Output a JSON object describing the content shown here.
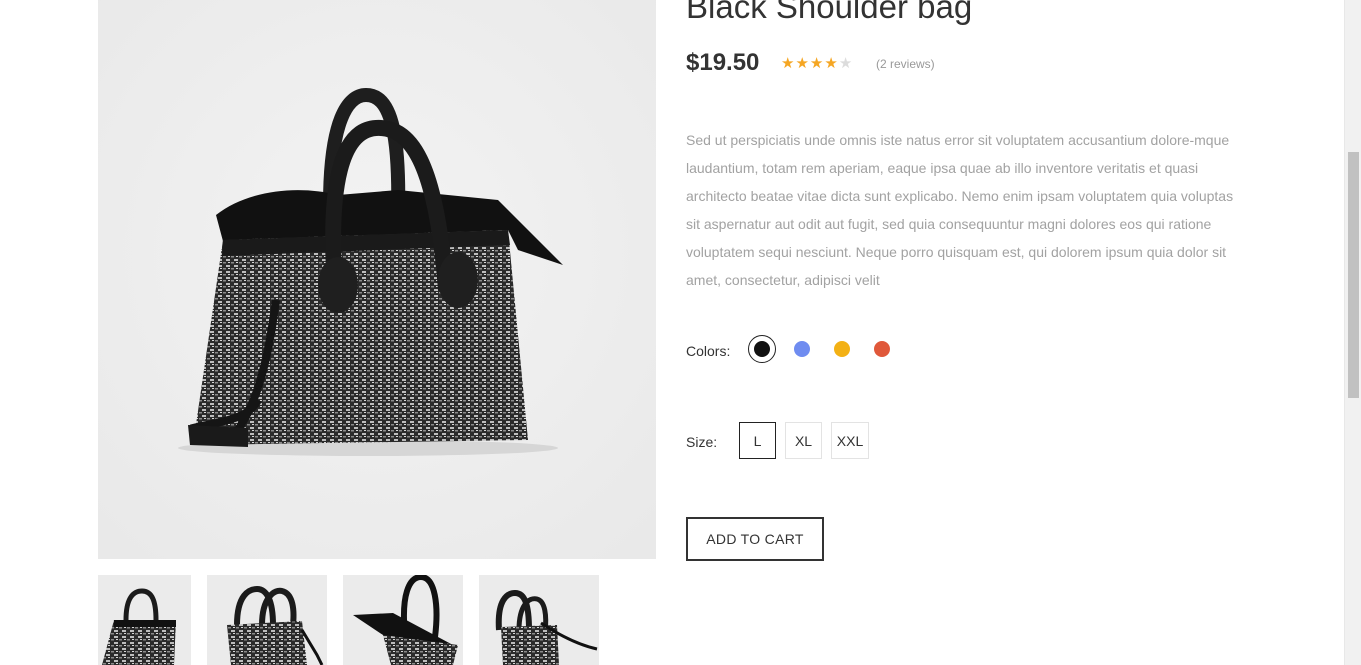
{
  "product": {
    "title": "Black Shoulder bag",
    "price": "$19.50",
    "rating": 4,
    "rating_max": 5,
    "reviews_text": "(2 reviews)",
    "description": "Sed ut perspiciatis unde omnis iste natus error sit voluptatem accusantium dolore-mque laudantium, totam rem aperiam, eaque ipsa quae ab illo inventore veritatis et quasi architecto beatae vitae dicta sunt explicabo. Nemo enim ipsam voluptatem quia voluptas sit aspernatur aut odit aut fugit, sed quia consequuntur magni dolores eos qui ratione voluptatem sequi nesciunt. Neque porro quisquam est, qui dolorem ipsum quia dolor sit amet, consectetur, adipisci velit"
  },
  "options": {
    "colors_label": "Colors:",
    "colors": [
      {
        "name": "black",
        "hex": "#111111",
        "selected": true
      },
      {
        "name": "blue",
        "hex": "#6f8cf0",
        "selected": false
      },
      {
        "name": "yellow",
        "hex": "#f3b115",
        "selected": false
      },
      {
        "name": "red",
        "hex": "#e0583a",
        "selected": false
      }
    ],
    "size_label": "Size:",
    "sizes": [
      {
        "label": "L",
        "selected": true
      },
      {
        "label": "XL",
        "selected": false
      },
      {
        "label": "XXL",
        "selected": false
      }
    ]
  },
  "actions": {
    "add_to_cart_label": "ADD TO CART"
  },
  "gallery": {
    "main_image": "black-woven-shoulder-bag-front",
    "thumbnails": [
      "bag-front",
      "bag-side",
      "bag-top-open",
      "bag-angled"
    ]
  }
}
